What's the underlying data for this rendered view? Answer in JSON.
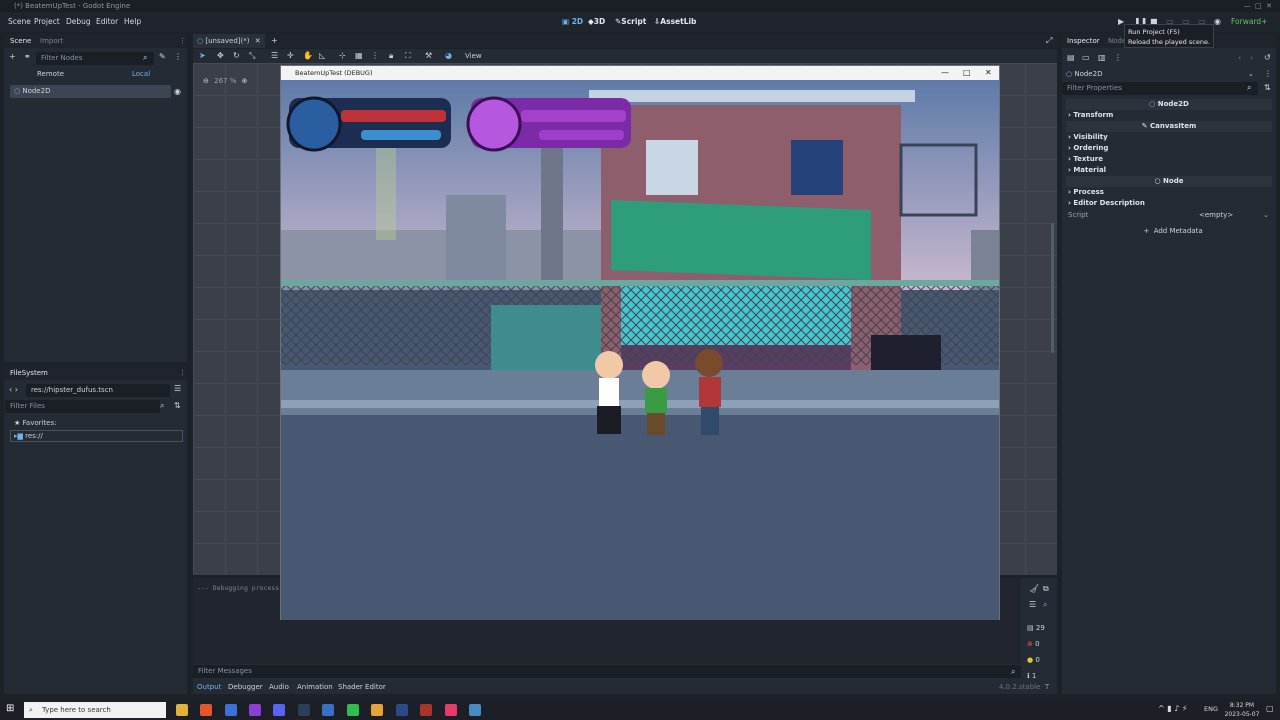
{
  "window_title": "(*) BeatemUpTest - Godot Engine",
  "menu": [
    "Scene",
    "Project",
    "Debug",
    "Editor",
    "Help"
  ],
  "modes": {
    "2d": "2D",
    "3d": "3D",
    "script": "Script",
    "assetlib": "AssetLib"
  },
  "renderer": "Forward+",
  "tooltip": {
    "line1": "Run Project (F5)",
    "line2": "Reload the played scene."
  },
  "scene_dock": {
    "tabs": {
      "scene": "Scene",
      "import": "Import"
    },
    "filter_placeholder": "Filter Nodes",
    "remote": "Remote",
    "local": "Local",
    "root_node": "Node2D"
  },
  "filesystem": {
    "title": "FileSystem",
    "path": "res://hipster_dufus.tscn",
    "filter_placeholder": "Filter Files",
    "favorites": "Favorites:",
    "root": "res://"
  },
  "editor_tab": {
    "label": "[unsaved](*)",
    "view": "View",
    "zoom": "267 %"
  },
  "game_window": {
    "title": "BeatemUpTest (DEBUG)"
  },
  "inspector": {
    "tabs": {
      "inspector": "Inspector",
      "node": "Node"
    },
    "object": "Node2D",
    "filter_placeholder": "Filter Properties",
    "sections": [
      {
        "type": "header",
        "label": "Node2D"
      },
      {
        "type": "group",
        "label": "Transform"
      },
      {
        "type": "header",
        "label": "CanvasItem"
      },
      {
        "type": "group",
        "label": "Visibility"
      },
      {
        "type": "group",
        "label": "Ordering"
      },
      {
        "type": "group",
        "label": "Texture"
      },
      {
        "type": "group",
        "label": "Material"
      },
      {
        "type": "header",
        "label": "Node"
      },
      {
        "type": "group",
        "label": "Process"
      },
      {
        "type": "group",
        "label": "Editor Description"
      }
    ],
    "script_label": "Script",
    "script_value": "<empty>",
    "add_metadata": "Add Metadata"
  },
  "bottom_panel": {
    "log": "--- Debugging process",
    "filter_placeholder": "Filter Messages",
    "tabs": [
      "Output",
      "Debugger",
      "Audio",
      "Animation",
      "Shader Editor"
    ],
    "version": "4.0.2.stable",
    "counts": {
      "messages": "29",
      "errors": "0",
      "warnings": "0",
      "info": "1"
    }
  },
  "taskbar": {
    "search_placeholder": "Type here to search",
    "lang": "ENG",
    "time": "8:32 PM",
    "date": "2023-05-07"
  },
  "colors": {
    "accent": "#5fa6e8",
    "health": "#c0323a",
    "energy": "#3b8fd0",
    "awning_green": "#2e9d7c"
  }
}
